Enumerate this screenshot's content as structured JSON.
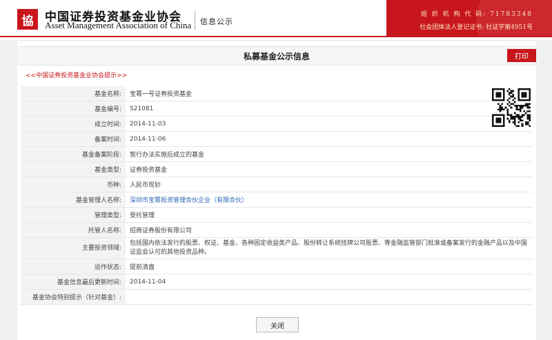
{
  "header": {
    "logo_glyph": "協",
    "org_name_cn": "中国证券投资基金业协会",
    "org_name_en": "Asset Management Association of China",
    "section": "信息公示",
    "line1": "组 织 机 构 代 码: 71783348",
    "line2": "社会团体法人登记证书: 社证字第4951号",
    "accent_color": "#c8161d"
  },
  "page": {
    "title": "私募基金公示信息",
    "print_label": "打印",
    "hint_link": "<<中国证券投资基金业协会提示>>",
    "close_label": "关闭"
  },
  "fund": {
    "rows": [
      {
        "label": "基金名称:",
        "value": "宝幂一号证券投资基金"
      },
      {
        "label": "基金编号:",
        "value": "S21081"
      },
      {
        "label": "成立时间:",
        "value": "2014-11-03"
      },
      {
        "label": "备案时间:",
        "value": "2014-11-06"
      },
      {
        "label": "基金备案阶段:",
        "value": "暂行办法实施后成立的基金"
      },
      {
        "label": "基金类型:",
        "value": "证券投资基金"
      },
      {
        "label": "币种:",
        "value": "人民币现钞"
      },
      {
        "label": "基金管理人名称:",
        "value": "深圳市宝幂投资管理合伙企业（有限合伙）"
      },
      {
        "label": "管理类型:",
        "value": "受托管理"
      },
      {
        "label": "托管人名称:",
        "value": "招商证券股份有限公司"
      },
      {
        "label": "主要投资领域:",
        "value": "包括国内依法发行的股票、权证、基金、各种固定收益类产品、股份转让系统挂牌公司股票、等金融监管部门批准或备案发行的金融产品以及中国证监会认可的其他投资品种。"
      },
      {
        "label": "运作状态:",
        "value": "提前清盘"
      },
      {
        "label": "基金信息最后更新时间:",
        "value": "2014-11-04"
      },
      {
        "label": "基金协会特别提示（针对基金）:",
        "value": ""
      }
    ]
  }
}
